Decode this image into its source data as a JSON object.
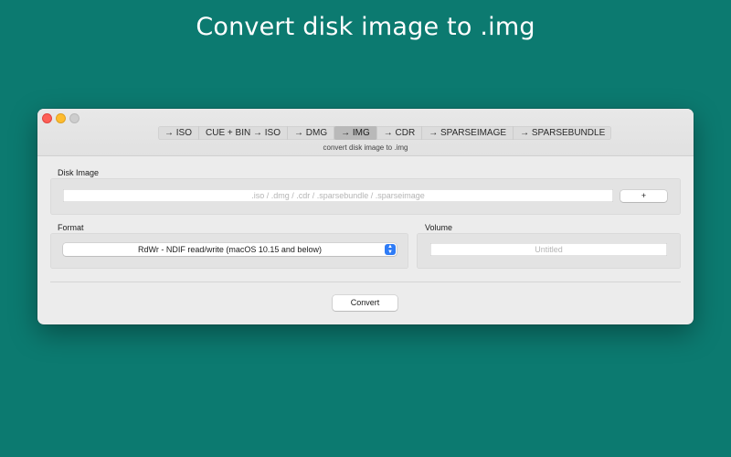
{
  "hero": {
    "title": "Convert disk image to .img"
  },
  "toolbar": {
    "tabs": [
      {
        "label": "→ ISO"
      },
      {
        "label": "CUE + BIN → ISO"
      },
      {
        "label": "→ DMG"
      },
      {
        "label": "→ IMG"
      },
      {
        "label": "→ CDR"
      },
      {
        "label": "→ SPARSEIMAGE"
      },
      {
        "label": "→ SPARSEBUNDLE"
      }
    ],
    "selected_tab": "→ IMG",
    "subtitle": "convert disk image to .img"
  },
  "disk_image": {
    "label": "Disk Image",
    "placeholder": ".iso / .dmg / .cdr / .sparsebundle / .sparseimage",
    "add_label": "+"
  },
  "format": {
    "label": "Format",
    "selected": "RdWr - NDIF read/write  (macOS 10.15 and below)"
  },
  "volume": {
    "label": "Volume",
    "placeholder": "Untitled"
  },
  "actions": {
    "convert_label": "Convert"
  },
  "colors": {
    "background": "#0c7a70",
    "accent": "#2f7cf6",
    "close": "#fe5f57",
    "minimize": "#febc2e"
  }
}
